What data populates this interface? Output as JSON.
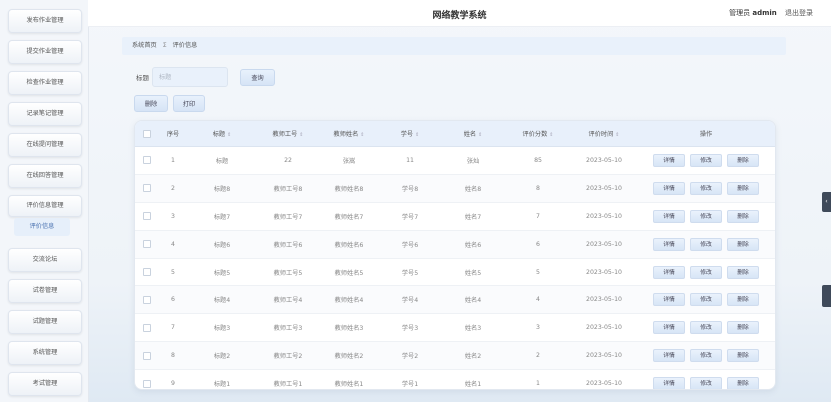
{
  "header": {
    "title": "网络教学系统",
    "user_prefix": "管理员",
    "username": "admin",
    "logout": "退出登录"
  },
  "sidebar": {
    "items": [
      {
        "label": "发布作业管理"
      },
      {
        "label": "提交作业管理"
      },
      {
        "label": "检查作业管理"
      },
      {
        "label": "记录笔记管理"
      },
      {
        "label": "在线提问管理"
      },
      {
        "label": "在线回答管理"
      },
      {
        "label": "评价信息管理"
      },
      {
        "label": "交流论坛"
      },
      {
        "label": "试卷管理"
      },
      {
        "label": "试题管理"
      },
      {
        "label": "系统管理"
      },
      {
        "label": "考试管理"
      }
    ],
    "open_submenu": {
      "label": "评价信息"
    }
  },
  "breadcrumb": {
    "home": "系统首页",
    "separator": "Σ",
    "current": "评价信息"
  },
  "search": {
    "label": "标题",
    "placeholder": "标题",
    "button": "查询"
  },
  "actions": {
    "delete": "删除",
    "print": "打印"
  },
  "table": {
    "headers": [
      "序号",
      "标题",
      "教师工号",
      "教师姓名",
      "学号",
      "姓名",
      "评价分数",
      "评价时间",
      "操作"
    ],
    "row_ops": {
      "detail": "详情",
      "edit": "修改",
      "delete": "删除"
    },
    "rows": [
      [
        "1",
        "标题",
        "22",
        "张嵩",
        "11",
        "张灿",
        "85",
        "2023-05-10"
      ],
      [
        "2",
        "标题8",
        "教师工号8",
        "教师姓名8",
        "学号8",
        "姓名8",
        "8",
        "2023-05-10"
      ],
      [
        "3",
        "标题7",
        "教师工号7",
        "教师姓名7",
        "学号7",
        "姓名7",
        "7",
        "2023-05-10"
      ],
      [
        "4",
        "标题6",
        "教师工号6",
        "教师姓名6",
        "学号6",
        "姓名6",
        "6",
        "2023-05-10"
      ],
      [
        "5",
        "标题5",
        "教师工号5",
        "教师姓名5",
        "学号5",
        "姓名5",
        "5",
        "2023-05-10"
      ],
      [
        "6",
        "标题4",
        "教师工号4",
        "教师姓名4",
        "学号4",
        "姓名4",
        "4",
        "2023-05-10"
      ],
      [
        "7",
        "标题3",
        "教师工号3",
        "教师姓名3",
        "学号3",
        "姓名3",
        "3",
        "2023-05-10"
      ],
      [
        "8",
        "标题2",
        "教师工号2",
        "教师姓名2",
        "学号2",
        "姓名2",
        "2",
        "2023-05-10"
      ],
      [
        "9",
        "标题1",
        "教师工号1",
        "教师姓名1",
        "学号1",
        "姓名1",
        "1",
        "2023-05-10"
      ]
    ]
  },
  "icons": {
    "sort": "sort-arrows-icon",
    "edge_toggle": "chevron-left-icon"
  }
}
